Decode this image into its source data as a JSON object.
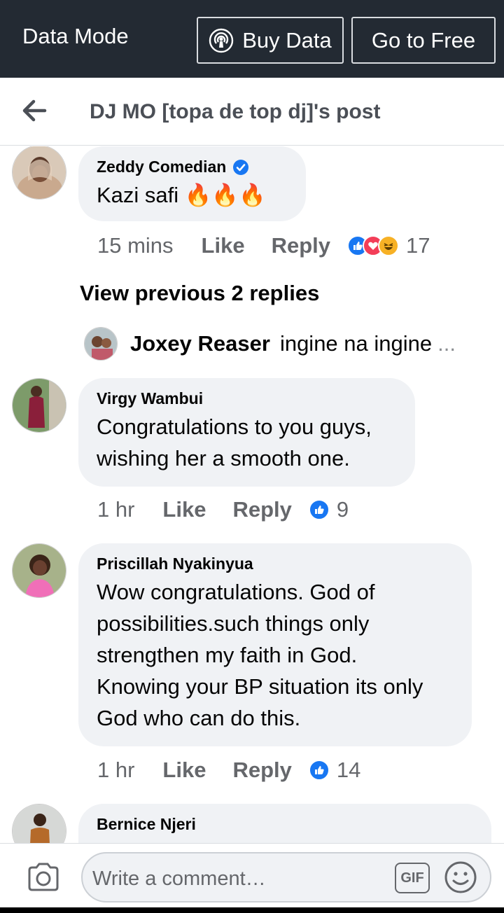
{
  "databar": {
    "mode_label": "Data Mode",
    "buy_label": "Buy Data",
    "free_label": "Go to Free"
  },
  "header": {
    "title": "DJ MO [topa de top dj]'s post"
  },
  "comments": [
    {
      "name": "Zeddy Comedian",
      "verified": true,
      "text": "Kazi safi 🔥🔥🔥",
      "time": "15 mins",
      "like": "Like",
      "reply": "Reply",
      "reactions": [
        "like",
        "love",
        "haha"
      ],
      "count": "17"
    },
    {
      "name": "Virgy Wambui",
      "text_lines": [
        "Congratulations to you guys,",
        "wishing her a smooth one."
      ],
      "time": "1 hr",
      "like": "Like",
      "reply": "Reply",
      "reactions": [
        "like"
      ],
      "count": "9"
    },
    {
      "name": "Priscillah Nyakinyua",
      "text_lines": [
        "Wow congratulations. God of",
        "possibilities.such things only",
        "strengthen my faith in God.",
        "Knowing your BP situation its only",
        "God who can do this."
      ],
      "time": "1 hr",
      "like": "Like",
      "reply": "Reply",
      "reactions": [
        "like"
      ],
      "count": "14"
    },
    {
      "name": "Bernice Njeri"
    }
  ],
  "thread": {
    "view_previous": "View previous 2 replies",
    "reply_name": "Joxey Reaser",
    "reply_text": "ingine na ingine",
    "reply_more": "..."
  },
  "composer": {
    "placeholder": "Write a comment…",
    "gif_label": "GIF"
  },
  "colors": {
    "databar_bg": "#232a33",
    "bubble_bg": "#f0f2f5",
    "like_blue": "#1877f2",
    "meta_gray": "#65676b"
  }
}
